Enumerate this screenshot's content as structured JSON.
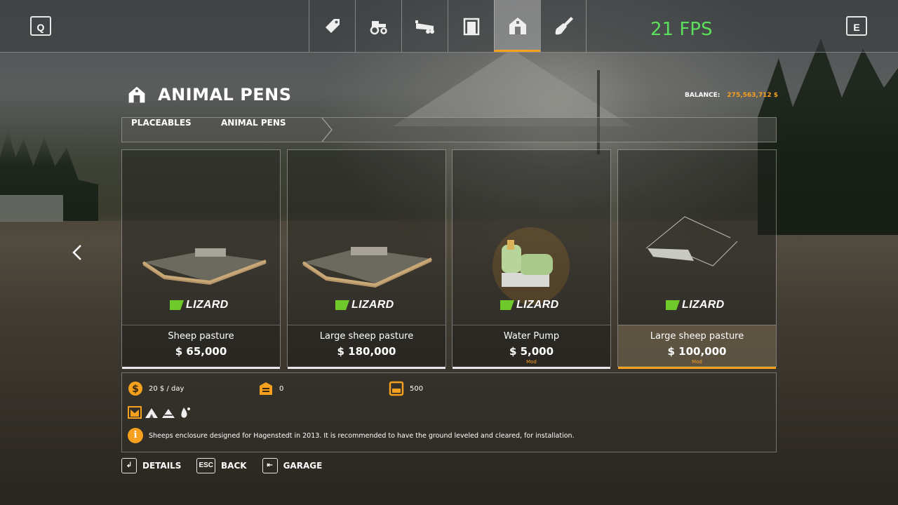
{
  "topbar": {
    "left_key": "Q",
    "right_key": "E",
    "fps": "21 FPS",
    "tabs": [
      {
        "icon": "price-tag-icon",
        "active": false
      },
      {
        "icon": "tractor-icon",
        "active": false
      },
      {
        "icon": "trailer-icon",
        "active": false
      },
      {
        "icon": "silo-icon",
        "active": false
      },
      {
        "icon": "barn-icon",
        "active": true
      },
      {
        "icon": "shovel-icon",
        "active": false
      }
    ]
  },
  "header": {
    "title": "ANIMAL PENS",
    "balance_label": "BALANCE:",
    "balance_value": "275,563,712 $"
  },
  "breadcrumb": [
    "PLACEABLES",
    "ANIMAL PENS"
  ],
  "items": [
    {
      "name": "Sheep pasture",
      "price": "$ 65,000",
      "brand": "LIZARD",
      "mod": "",
      "selection": "white"
    },
    {
      "name": "Large sheep pasture",
      "price": "$ 180,000",
      "brand": "LIZARD",
      "mod": "",
      "selection": "white"
    },
    {
      "name": "Water Pump",
      "price": "$ 5,000",
      "brand": "LIZARD",
      "mod": "Mod",
      "selection": "white"
    },
    {
      "name": "Large sheep pasture",
      "price": "$ 100,000",
      "brand": "LIZARD",
      "mod": "Mod",
      "selection": "orange"
    }
  ],
  "details": {
    "upkeep": "20 $ / day",
    "capacity": "0",
    "storage": "500",
    "food_icons": [
      "animal-trough-icon",
      "grass-icon",
      "hay-icon",
      "water-icon"
    ],
    "description": "Sheeps enclosure designed for Hagenstedt in 2013. It is recommended to have the ground leveled and cleared, for installation."
  },
  "footer": [
    {
      "key": "↲",
      "label": "DETAILS"
    },
    {
      "key": "ESC",
      "label": "BACK"
    },
    {
      "key": "⇤",
      "label": "GARAGE"
    }
  ],
  "colors": {
    "accent": "#f5a01f",
    "fps": "#5be05b",
    "brand_green": "#6fc92a"
  }
}
